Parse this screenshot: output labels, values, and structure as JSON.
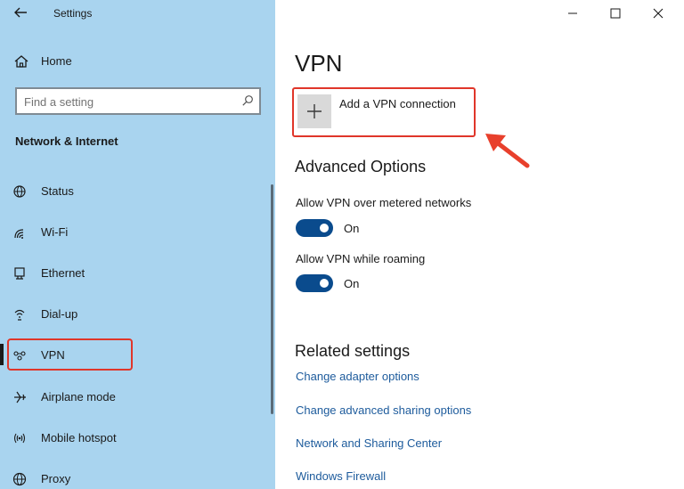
{
  "window": {
    "title": "Settings",
    "icons": {
      "back": "back-arrow-icon",
      "minimize": "minimize-icon",
      "maximize": "maximize-icon",
      "close": "close-icon"
    }
  },
  "sidebar": {
    "home_label": "Home",
    "search_placeholder": "Find a setting",
    "section_heading": "Network & Internet",
    "items": [
      {
        "label": "Status",
        "icon": "globe-status-icon"
      },
      {
        "label": "Wi-Fi",
        "icon": "wifi-icon"
      },
      {
        "label": "Ethernet",
        "icon": "ethernet-icon"
      },
      {
        "label": "Dial-up",
        "icon": "dialup-icon"
      },
      {
        "label": "VPN",
        "icon": "vpn-icon",
        "selected": true
      },
      {
        "label": "Airplane mode",
        "icon": "airplane-icon"
      },
      {
        "label": "Mobile hotspot",
        "icon": "hotspot-icon"
      },
      {
        "label": "Proxy",
        "icon": "globe-icon"
      }
    ]
  },
  "main": {
    "title": "VPN",
    "add_vpn_label": "Add a VPN connection",
    "advanced_heading": "Advanced Options",
    "options": [
      {
        "label": "Allow VPN over metered networks",
        "state": "On"
      },
      {
        "label": "Allow VPN while roaming",
        "state": "On"
      }
    ],
    "related_heading": "Related settings",
    "links": [
      "Change adapter options",
      "Change advanced sharing options",
      "Network and Sharing Center",
      "Windows Firewall"
    ]
  },
  "colors": {
    "sidebar_bg": "#a9d4ef",
    "accent": "#0a4b8d",
    "link": "#1d5b9c",
    "annotation": "#e0362a"
  }
}
